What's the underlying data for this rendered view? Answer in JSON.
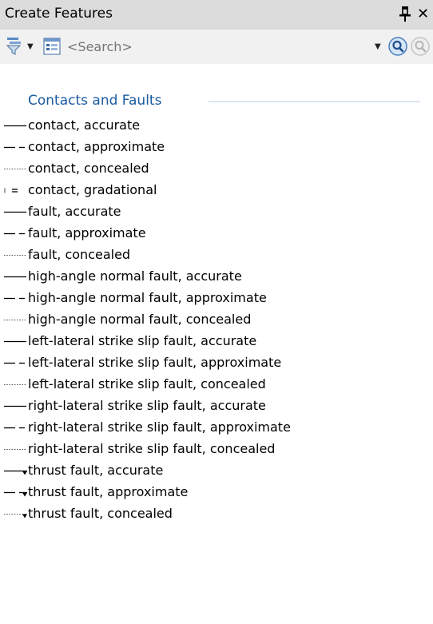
{
  "window": {
    "title": "Create Features",
    "pin_icon": "pushpin-icon",
    "close_icon": "close-icon",
    "close_glyph": "✕"
  },
  "toolbar": {
    "filter_icon": "filter-icon",
    "view_icon": "organize-templates-icon",
    "search": {
      "value": "",
      "placeholder": "<Search>"
    },
    "search_button_icon": "search-icon",
    "locate_button_icon": "locate-icon",
    "dropdown_glyph": "▼"
  },
  "group": {
    "name": "Contacts and Faults",
    "items": [
      {
        "label": "contact, accurate",
        "symbol": "solid"
      },
      {
        "label": "contact, approximate",
        "symbol": "dashed"
      },
      {
        "label": "contact, concealed",
        "symbol": "dotted"
      },
      {
        "label": "contact, gradational",
        "symbol": "gradational"
      },
      {
        "label": "fault, accurate",
        "symbol": "solid"
      },
      {
        "label": "fault, approximate",
        "symbol": "dashed"
      },
      {
        "label": "fault, concealed",
        "symbol": "dotted"
      },
      {
        "label": "high-angle normal fault, accurate",
        "symbol": "solid"
      },
      {
        "label": "high-angle normal fault, approximate",
        "symbol": "dashed"
      },
      {
        "label": "high-angle normal fault, concealed",
        "symbol": "dotted"
      },
      {
        "label": "left-lateral strike slip fault, accurate",
        "symbol": "solid"
      },
      {
        "label": "left-lateral strike slip fault, approximate",
        "symbol": "dashed"
      },
      {
        "label": "left-lateral strike slip fault, concealed",
        "symbol": "dotted"
      },
      {
        "label": "right-lateral strike slip fault, accurate",
        "symbol": "solid"
      },
      {
        "label": "right-lateral strike slip fault, approximate",
        "symbol": "dashed"
      },
      {
        "label": "right-lateral strike slip fault, concealed",
        "symbol": "dotted"
      },
      {
        "label": "thrust fault, accurate",
        "symbol": "thrust-solid"
      },
      {
        "label": "thrust fault, approximate",
        "symbol": "thrust-dashed"
      },
      {
        "label": "thrust fault, concealed",
        "symbol": "thrust-dotted"
      }
    ]
  },
  "colors": {
    "titlebar": "#dcdcdc",
    "toolbar": "#f1f1f1",
    "group_header": "#1b5aa0"
  }
}
